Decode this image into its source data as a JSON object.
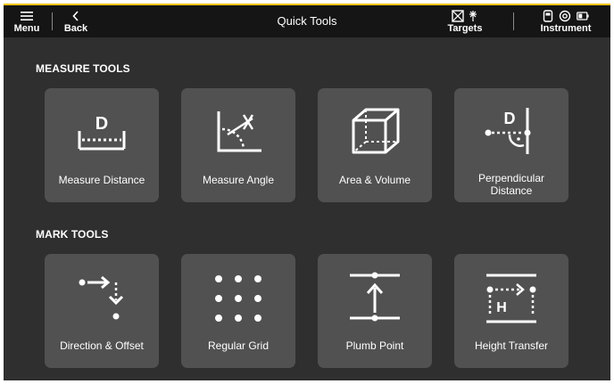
{
  "header": {
    "menu_label": "Menu",
    "back_label": "Back",
    "title": "Quick Tools",
    "targets_label": "Targets",
    "instrument_label": "Instrument"
  },
  "sections": {
    "measure": {
      "title": "MEASURE TOOLS",
      "tiles": [
        {
          "label": "Measure Distance",
          "icon": "measure-distance-icon"
        },
        {
          "label": "Measure Angle",
          "icon": "measure-angle-icon"
        },
        {
          "label": "Area & Volume",
          "icon": "area-volume-icon"
        },
        {
          "label": "Perpendicular Distance",
          "icon": "perpendicular-distance-icon"
        }
      ]
    },
    "mark": {
      "title": "MARK TOOLS",
      "tiles": [
        {
          "label": "Direction & Offset",
          "icon": "direction-offset-icon"
        },
        {
          "label": "Regular Grid",
          "icon": "regular-grid-icon"
        },
        {
          "label": "Plumb Point",
          "icon": "plumb-point-icon"
        },
        {
          "label": "Height Transfer",
          "icon": "height-transfer-icon"
        }
      ]
    }
  },
  "colors": {
    "background": "#2f2f2f",
    "topbar": "#151515",
    "tile": "#515151",
    "accent": "#f2c300",
    "text": "#ffffff"
  }
}
